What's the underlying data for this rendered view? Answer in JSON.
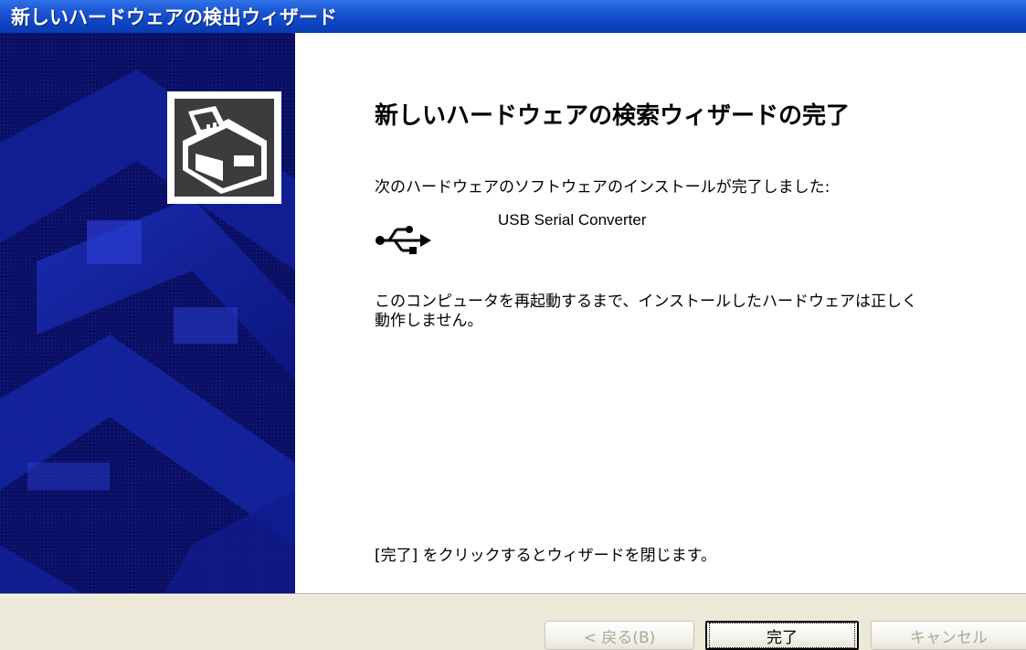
{
  "window": {
    "title": "新しいハードウェアの検出ウィザード"
  },
  "content": {
    "heading": "新しいハードウェアの検索ウィザードの完了",
    "install_complete_text": "次のハードウェアのソフトウェアのインストールが完了しました:",
    "device_name": "USB Serial Converter",
    "device_icon": "usb-icon",
    "restart_notice_line1": "このコンピュータを再起動するまで、インストールしたハードウェアは正しく",
    "restart_notice_line2": "動作しません。",
    "close_instruction": "[完了] をクリックするとウィザードを閉じます。"
  },
  "buttons": {
    "back_label": "< 戻る(B)",
    "finish_label": "完了",
    "cancel_label": "キャンセル"
  },
  "colors": {
    "titlebar": "#0e44c4",
    "side_panel": "#0a0f63",
    "footer": "#ece9d8",
    "disabled_text": "#aca899"
  }
}
